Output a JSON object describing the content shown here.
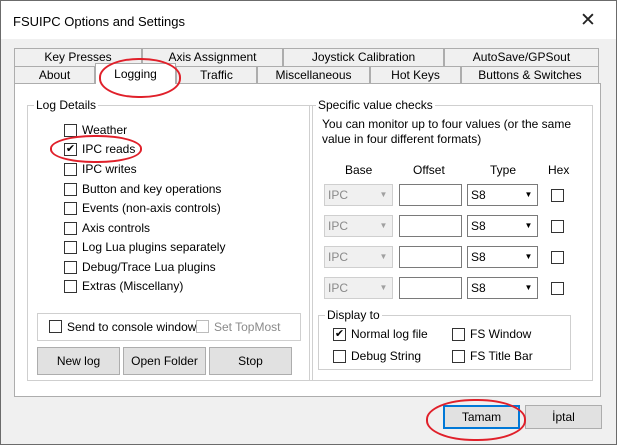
{
  "window": {
    "title": "FSUIPC Options and Settings",
    "close_glyph": "✕"
  },
  "tabs_back": [
    {
      "label": "Key Presses"
    },
    {
      "label": "Axis Assignment"
    },
    {
      "label": "Joystick Calibration"
    },
    {
      "label": "AutoSave/GPSout"
    }
  ],
  "tabs_front": [
    {
      "label": "About"
    },
    {
      "label": "Logging",
      "active": true
    },
    {
      "label": "Traffic"
    },
    {
      "label": "Miscellaneous"
    },
    {
      "label": "Hot Keys"
    },
    {
      "label": "Buttons & Switches"
    }
  ],
  "log_details": {
    "title": "Log Details",
    "options": [
      {
        "label": "Weather",
        "checked": false
      },
      {
        "label": "IPC reads",
        "checked": true
      },
      {
        "label": "IPC writes",
        "checked": false
      },
      {
        "label": "Button and key operations",
        "checked": false
      },
      {
        "label": "Events (non-axis controls)",
        "checked": false
      },
      {
        "label": "Axis controls",
        "checked": false
      },
      {
        "label": "Log Lua plugins separately",
        "checked": false
      },
      {
        "label": "Debug/Trace Lua plugins",
        "checked": false
      },
      {
        "label": "Extras (Miscellany)",
        "checked": false
      }
    ],
    "console": {
      "label": "Send to console window",
      "checked": false
    },
    "topmost": {
      "label": "Set TopMost",
      "checked": false,
      "disabled": true
    },
    "buttons": {
      "new_log": "New log",
      "open_folder": "Open Folder",
      "stop": "Stop"
    }
  },
  "specific": {
    "title": "Specific value checks",
    "note_line1": "You can monitor up to four values (or the same",
    "note_line2": "value in four different formats)",
    "headers": {
      "base": "Base",
      "offset": "Offset",
      "type": "Type",
      "hex": "Hex"
    },
    "rows": [
      {
        "base": "IPC",
        "offset": "",
        "type": "S8",
        "hex": false
      },
      {
        "base": "IPC",
        "offset": "",
        "type": "S8",
        "hex": false
      },
      {
        "base": "IPC",
        "offset": "",
        "type": "S8",
        "hex": false
      },
      {
        "base": "IPC",
        "offset": "",
        "type": "S8",
        "hex": false
      }
    ]
  },
  "display_to": {
    "title": "Display to",
    "options": [
      {
        "label": "Normal log file",
        "checked": true
      },
      {
        "label": "FS Window",
        "checked": false
      },
      {
        "label": "Debug String",
        "checked": false
      },
      {
        "label": "FS Title Bar",
        "checked": false
      }
    ]
  },
  "footer": {
    "ok": "Tamam",
    "cancel": "İptal"
  },
  "check_glyph": "✔",
  "arrow_glyph": "▼",
  "annotation_color": "#e0202a"
}
